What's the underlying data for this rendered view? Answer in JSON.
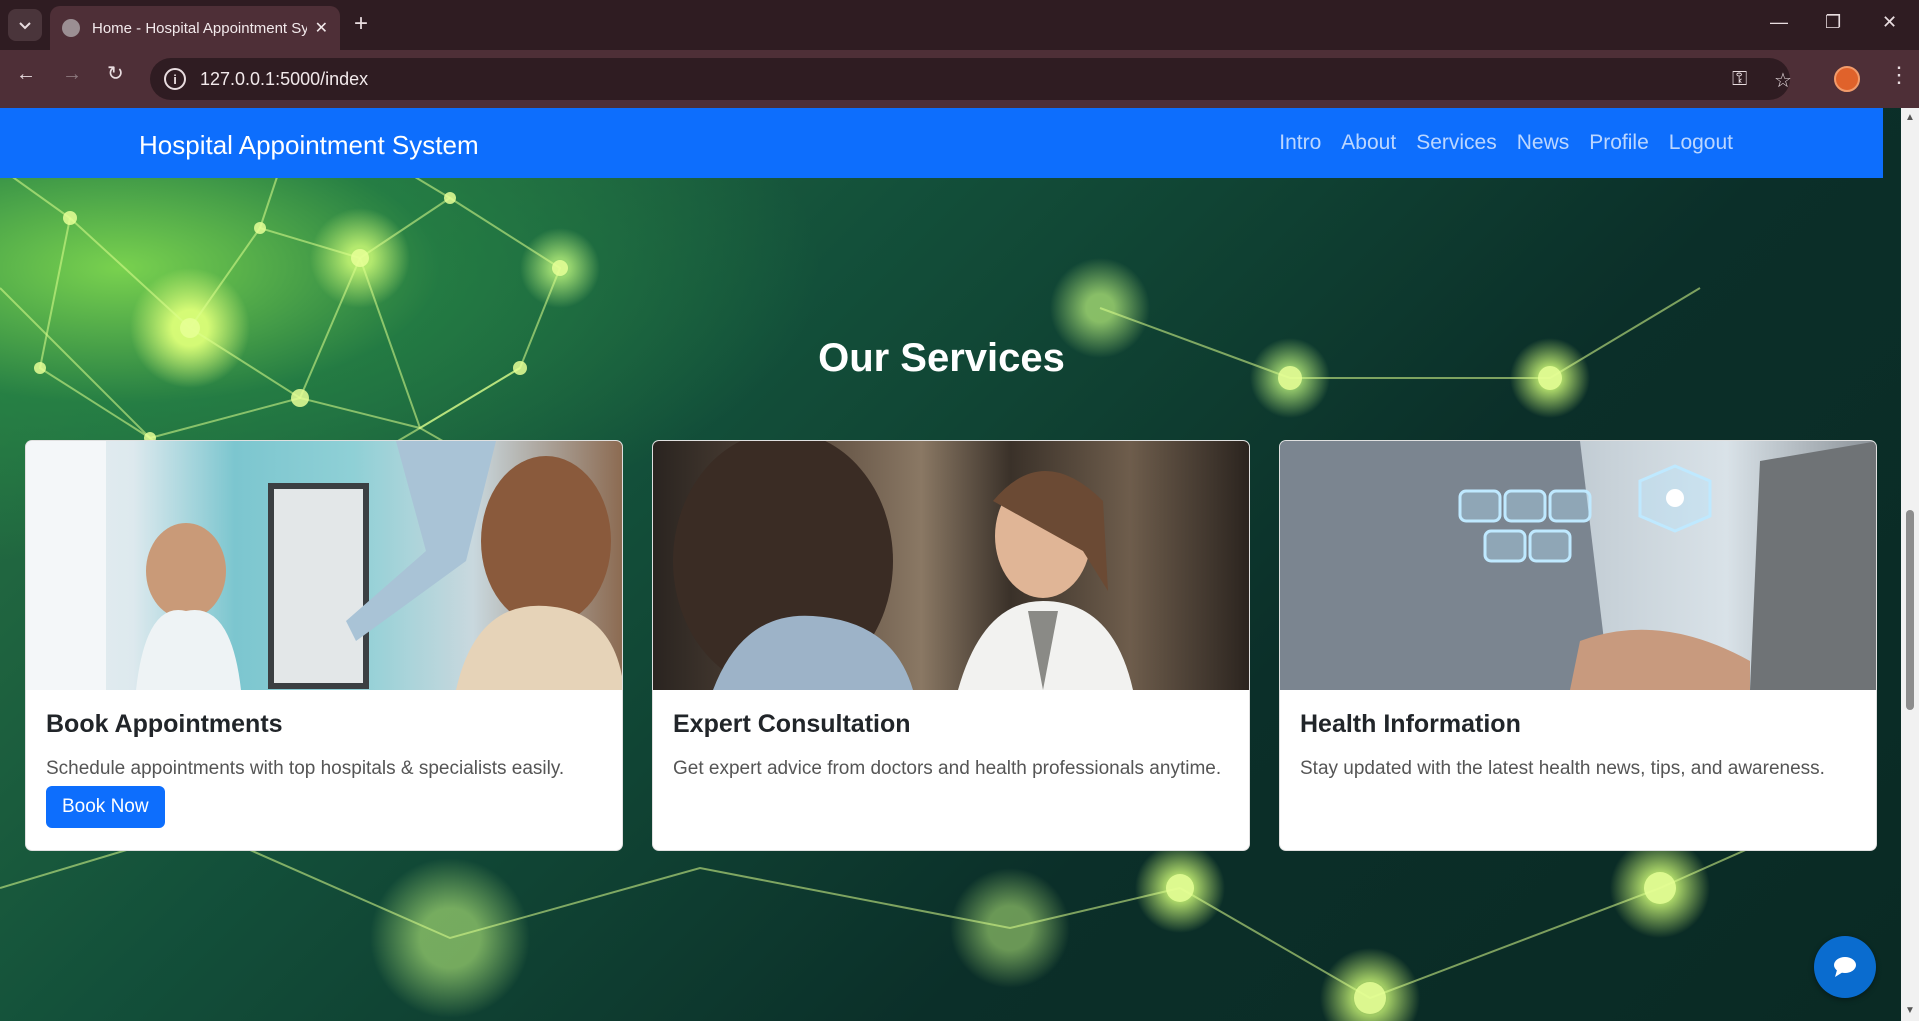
{
  "browser": {
    "tab_title": "Home - Hospital Appointment System",
    "url": "127.0.0.1:5000/index"
  },
  "site": {
    "brand": "Hospital Appointment System",
    "nav": [
      "Intro",
      "About",
      "Services",
      "News",
      "Profile",
      "Logout"
    ]
  },
  "services": {
    "title": "Our Services",
    "cards": [
      {
        "title": "Book Appointments",
        "text": "Schedule appointments with top hospitals & specialists easily.",
        "button": "Book Now"
      },
      {
        "title": "Expert Consultation",
        "text": "Get expert advice from doctors and health professionals anytime."
      },
      {
        "title": "Health Information",
        "text": "Stay updated with the latest health news, tips, and awareness."
      }
    ]
  },
  "colors": {
    "primary": "#0d6efd",
    "browser_frame": "#4e2f37",
    "chat_button": "#0a6ccf"
  },
  "icons": [
    "tab-search-icon",
    "globe-icon",
    "close-icon",
    "plus-icon",
    "minimize-icon",
    "restore-icon",
    "back-icon",
    "forward-icon",
    "reload-icon",
    "info-icon",
    "key-icon",
    "star-icon",
    "menu-icon",
    "chat-icon"
  ]
}
